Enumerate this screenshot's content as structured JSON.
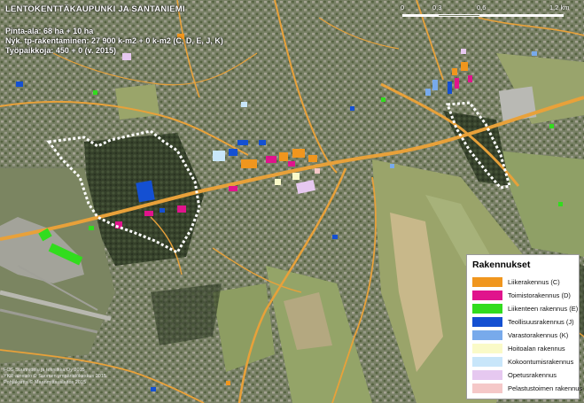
{
  "header": {
    "title": "LENTOKENTTÄKAUPUNKI JA SANTANIEMI",
    "area": "Pinta-ala: 68 ha + 10 ha",
    "construction": "Nyk. tp-rakentaminen: 27 900 k-m2 + 0 k-m2 (C, D, E, J, K)",
    "jobs": "Työpaikkoja: 450 + 0 (v. 2015)"
  },
  "scale": {
    "labels": [
      "0",
      "0,3",
      "0,6",
      "1,2 km"
    ]
  },
  "legend": {
    "title": "Rakennukset",
    "items": [
      {
        "label": "Liikerakennus (C)",
        "color": "#f0961e"
      },
      {
        "label": "Toimistorakennus (D)",
        "color": "#e0148c"
      },
      {
        "label": "Liikenteen rakennus (E)",
        "color": "#32dc1e"
      },
      {
        "label": "Teollisuusrakennus (J)",
        "color": "#1450d2"
      },
      {
        "label": "Varastorakennus (K)",
        "color": "#78aaeb"
      },
      {
        "label": "Hoitoalan rakennus",
        "color": "#fafac8"
      },
      {
        "label": "Kokoontumisrakennus",
        "color": "#c8e6fa"
      },
      {
        "label": "Opetusrakennus",
        "color": "#e6c8f0"
      },
      {
        "label": "Pelastustoimen rakennus",
        "color": "#f5c8c8"
      }
    ]
  },
  "credits": [
    "FCG Suunnittelu ja tekniikka Oy 2015",
    "YKR-aineisto © Suomen ympäristökeskus 2015",
    "Pohjakartta © Maanmittauslaitos 2015"
  ],
  "colors": {
    "road": "#e8a13a",
    "boundary": "#ffffff",
    "field": "#8c9c5a",
    "forest": "#3e4a2e",
    "residential": "#8a8f7a"
  }
}
